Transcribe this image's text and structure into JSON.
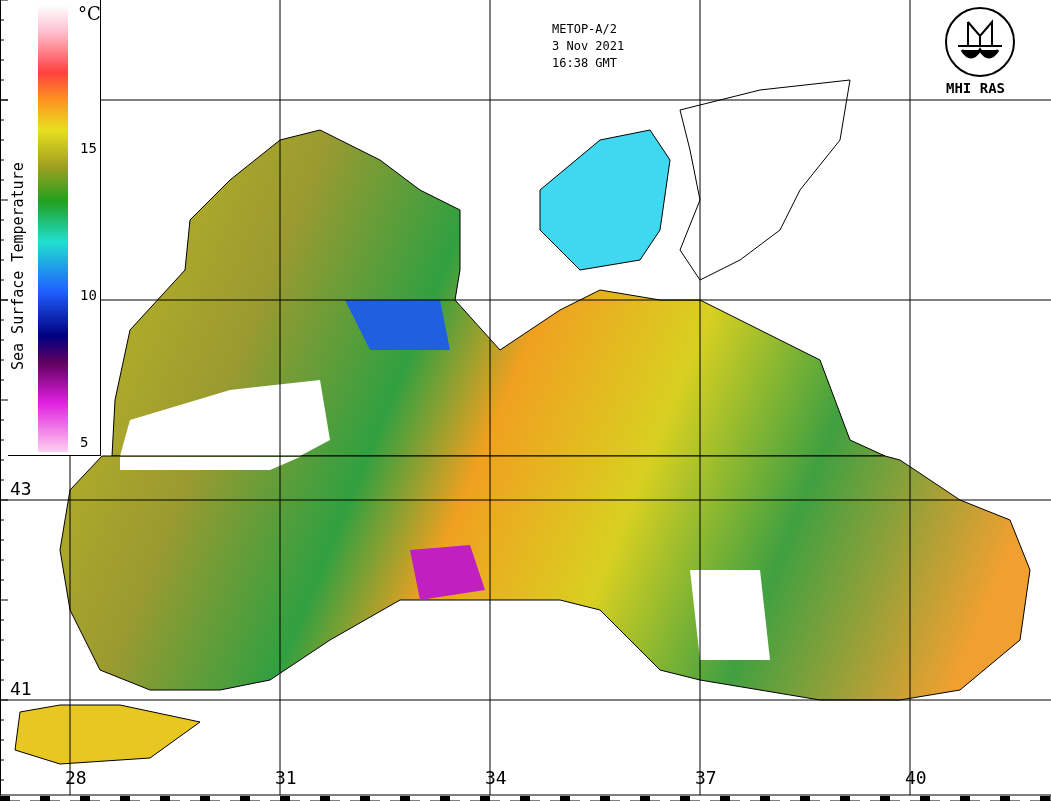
{
  "header": {
    "satellite": "METOP-A/2",
    "date": "3 Nov 2021",
    "time": "16:38 GMT"
  },
  "logo": {
    "text": "MHI RAS"
  },
  "legend": {
    "title": "Sea Surface Temperature",
    "unit": "°C",
    "ticks": [
      "15",
      "10",
      "5"
    ]
  },
  "grid": {
    "latitudes": [
      "43",
      "41"
    ],
    "longitudes": [
      "28",
      "31",
      "34",
      "37",
      "40"
    ]
  }
}
